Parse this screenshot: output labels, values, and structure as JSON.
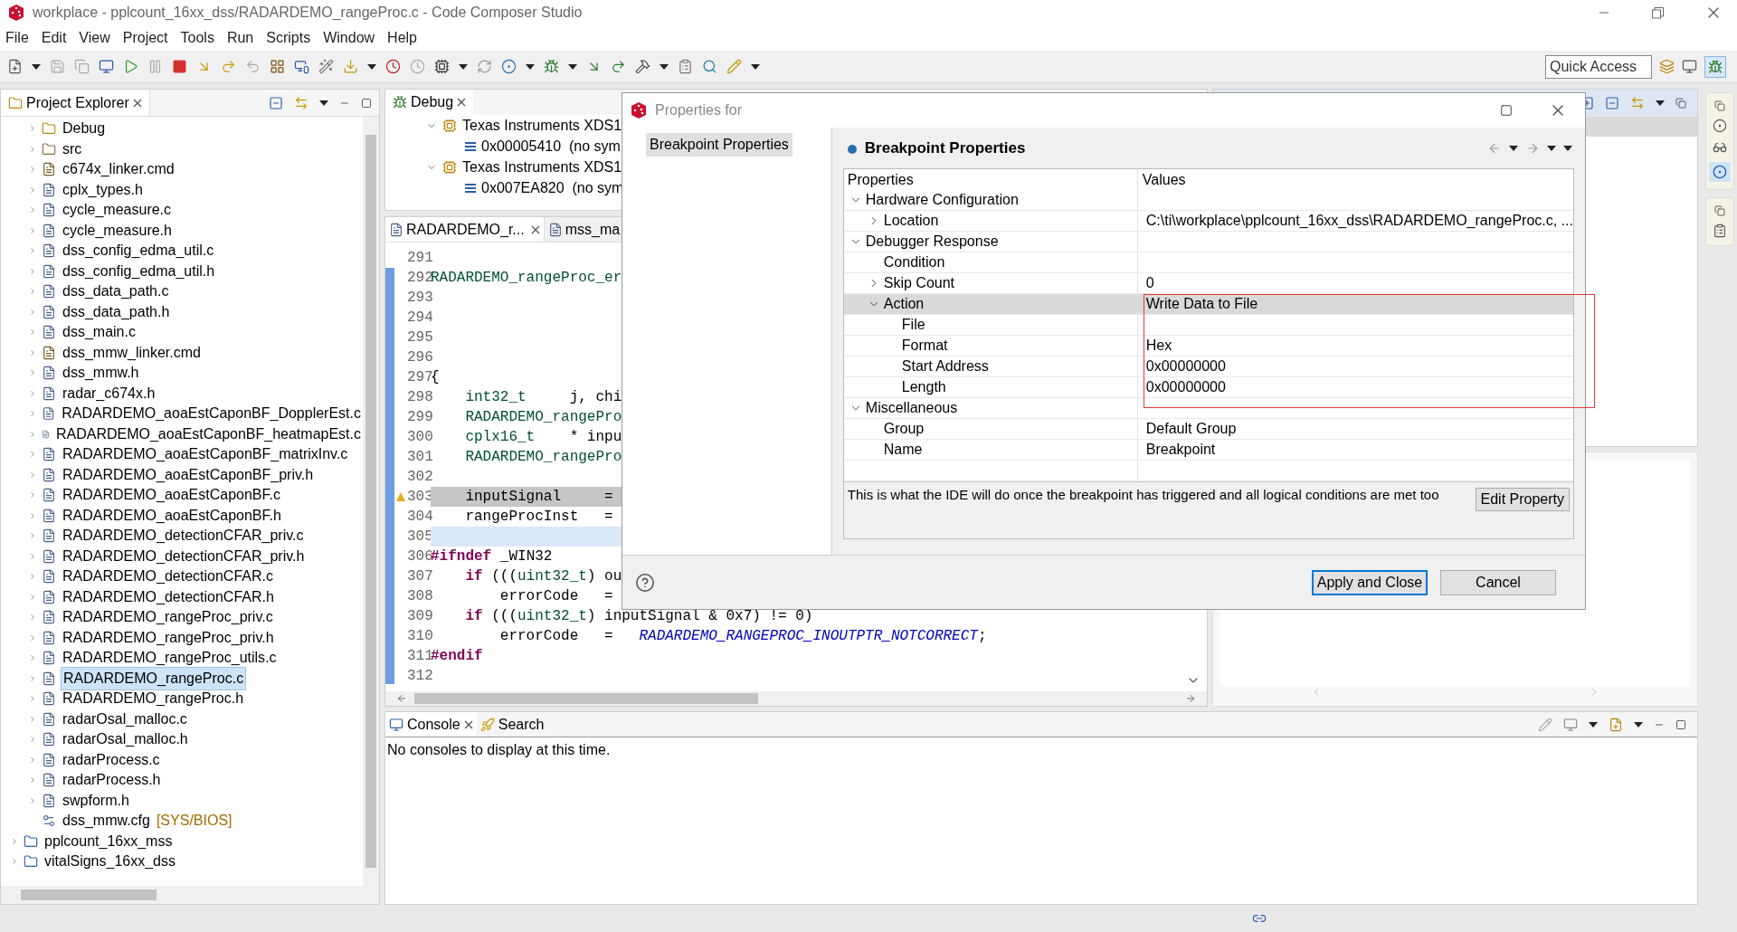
{
  "window": {
    "title": "workplace - pplcount_16xx_dss/RADARDEMO_rangeProc.c - Code Composer Studio"
  },
  "menu": [
    "File",
    "Edit",
    "View",
    "Project",
    "Tools",
    "Run",
    "Scripts",
    "Window",
    "Help"
  ],
  "quick_access": {
    "placeholder": "Quick Access"
  },
  "project_explorer": {
    "title": "Project Explorer",
    "items": [
      {
        "label": "Debug",
        "kind": "folder",
        "expandable": true,
        "selected": false
      },
      {
        "label": "src",
        "kind": "source-folder",
        "expandable": true,
        "selected": false
      },
      {
        "label": "c674x_linker.cmd",
        "kind": "cmd",
        "expandable": true,
        "selected": false
      },
      {
        "label": "cplx_types.h",
        "kind": "file",
        "expandable": true,
        "selected": false
      },
      {
        "label": "cycle_measure.c",
        "kind": "file",
        "expandable": true,
        "selected": false
      },
      {
        "label": "cycle_measure.h",
        "kind": "file",
        "expandable": true,
        "selected": false
      },
      {
        "label": "dss_config_edma_util.c",
        "kind": "file",
        "expandable": true,
        "selected": false
      },
      {
        "label": "dss_config_edma_util.h",
        "kind": "file",
        "expandable": true,
        "selected": false
      },
      {
        "label": "dss_data_path.c",
        "kind": "file",
        "expandable": true,
        "selected": false
      },
      {
        "label": "dss_data_path.h",
        "kind": "file",
        "expandable": true,
        "selected": false
      },
      {
        "label": "dss_main.c",
        "kind": "file",
        "expandable": true,
        "selected": false
      },
      {
        "label": "dss_mmw_linker.cmd",
        "kind": "cmd",
        "expandable": true,
        "selected": false
      },
      {
        "label": "dss_mmw.h",
        "kind": "file",
        "expandable": true,
        "selected": false
      },
      {
        "label": "radar_c674x.h",
        "kind": "file",
        "expandable": true,
        "selected": false
      },
      {
        "label": "RADARDEMO_aoaEstCaponBF_DopplerEst.c",
        "kind": "file",
        "expandable": true,
        "selected": false
      },
      {
        "label": "RADARDEMO_aoaEstCaponBF_heatmapEst.c",
        "kind": "file",
        "expandable": true,
        "selected": false
      },
      {
        "label": "RADARDEMO_aoaEstCaponBF_matrixInv.c",
        "kind": "file",
        "expandable": true,
        "selected": false
      },
      {
        "label": "RADARDEMO_aoaEstCaponBF_priv.h",
        "kind": "file",
        "expandable": true,
        "selected": false
      },
      {
        "label": "RADARDEMO_aoaEstCaponBF.c",
        "kind": "file",
        "expandable": true,
        "selected": false
      },
      {
        "label": "RADARDEMO_aoaEstCaponBF.h",
        "kind": "file",
        "expandable": true,
        "selected": false
      },
      {
        "label": "RADARDEMO_detectionCFAR_priv.c",
        "kind": "file",
        "expandable": true,
        "selected": false
      },
      {
        "label": "RADARDEMO_detectionCFAR_priv.h",
        "kind": "file",
        "expandable": true,
        "selected": false
      },
      {
        "label": "RADARDEMO_detectionCFAR.c",
        "kind": "file",
        "expandable": true,
        "selected": false
      },
      {
        "label": "RADARDEMO_detectionCFAR.h",
        "kind": "file",
        "expandable": true,
        "selected": false
      },
      {
        "label": "RADARDEMO_rangeProc_priv.c",
        "kind": "file",
        "expandable": true,
        "selected": false
      },
      {
        "label": "RADARDEMO_rangeProc_priv.h",
        "kind": "file",
        "expandable": true,
        "selected": false
      },
      {
        "label": "RADARDEMO_rangeProc_utils.c",
        "kind": "file",
        "expandable": true,
        "selected": false
      },
      {
        "label": "RADARDEMO_rangeProc.c",
        "kind": "file",
        "expandable": true,
        "selected": true
      },
      {
        "label": "RADARDEMO_rangeProc.h",
        "kind": "file",
        "expandable": true,
        "selected": false
      },
      {
        "label": "radarOsal_malloc.c",
        "kind": "file",
        "expandable": true,
        "selected": false
      },
      {
        "label": "radarOsal_malloc.h",
        "kind": "file",
        "expandable": true,
        "selected": false
      },
      {
        "label": "radarProcess.c",
        "kind": "file",
        "expandable": true,
        "selected": false
      },
      {
        "label": "radarProcess.h",
        "kind": "file",
        "expandable": true,
        "selected": false
      },
      {
        "label": "swpform.h",
        "kind": "file",
        "expandable": true,
        "selected": false
      },
      {
        "label": "dss_mmw.cfg",
        "kind": "config",
        "expandable": false,
        "selected": false,
        "decoration": "[SYS/BIOS]"
      }
    ],
    "projects": [
      {
        "label": "pplcount_16xx_mss",
        "expandable": true,
        "selected": false
      },
      {
        "label": "vitalSigns_16xx_dss",
        "expandable": true,
        "selected": false
      }
    ]
  },
  "debug": {
    "title": "Debug",
    "targets": [
      {
        "label": "Texas Instruments XDS1",
        "expanded": true,
        "frames": [
          "0x00005410  (no sym"
        ]
      },
      {
        "label": "Texas Instruments XDS1",
        "expanded": true,
        "frames": [
          "0x007EA820  (no sym"
        ]
      }
    ]
  },
  "editor": {
    "tabs": [
      {
        "label": "RADARDEMO_r...",
        "selected": true
      },
      {
        "label": "mss_ma",
        "selected": false
      }
    ],
    "lines": [
      {
        "number": "291",
        "current": false,
        "cursor": false
      },
      {
        "number": "292",
        "current": false,
        "cursor": false,
        "segments": [
          {
            "kind": "type",
            "text": "RADARDEMO_rangeProc_er"
          }
        ]
      },
      {
        "number": "293",
        "current": false,
        "cursor": false
      },
      {
        "number": "294",
        "current": false,
        "cursor": false
      },
      {
        "number": "295",
        "current": false,
        "cursor": false
      },
      {
        "number": "296",
        "current": false,
        "cursor": false
      },
      {
        "number": "297",
        "current": false,
        "cursor": false,
        "segments": [
          {
            "kind": "text",
            "text": "{"
          }
        ]
      },
      {
        "number": "298",
        "current": false,
        "cursor": false,
        "segments": [
          {
            "kind": "type",
            "text": "    int32_t"
          },
          {
            "kind": "text",
            "text": "     j, chi"
          }
        ]
      },
      {
        "number": "299",
        "current": false,
        "cursor": false,
        "segments": [
          {
            "kind": "type",
            "text": "    RADARDEMO_rangePro"
          }
        ]
      },
      {
        "number": "300",
        "current": false,
        "cursor": false,
        "segments": [
          {
            "kind": "type",
            "text": "    cplx16_t"
          },
          {
            "kind": "text",
            "text": "    * inpu"
          }
        ]
      },
      {
        "number": "301",
        "current": false,
        "cursor": false,
        "segments": [
          {
            "kind": "type",
            "text": "    RADARDEMO_rangePro"
          }
        ]
      },
      {
        "number": "302",
        "current": false,
        "cursor": false
      },
      {
        "number": "303",
        "current": true,
        "cursor": false,
        "breakpoint": true,
        "segments": [
          {
            "kind": "text",
            "text": "    inputSignal     ="
          }
        ]
      },
      {
        "number": "304",
        "current": false,
        "cursor": false,
        "segments": [
          {
            "kind": "text",
            "text": "    rangeProcInst   ="
          }
        ]
      },
      {
        "number": "305",
        "current": false,
        "cursor": true
      },
      {
        "number": "306",
        "current": false,
        "cursor": false,
        "segments": [
          {
            "kind": "keyword",
            "text": "#ifndef"
          },
          {
            "kind": "text",
            "text": " _WIN32"
          }
        ]
      },
      {
        "number": "307",
        "current": false,
        "cursor": false,
        "segments": [
          {
            "kind": "keyword",
            "text": "    if"
          },
          {
            "kind": "text",
            "text": " ((("
          },
          {
            "kind": "type",
            "text": "uint32_t"
          },
          {
            "kind": "text",
            "text": ") ou"
          }
        ]
      },
      {
        "number": "308",
        "current": false,
        "cursor": false,
        "segments": [
          {
            "kind": "text",
            "text": "        errorCode   ="
          }
        ]
      },
      {
        "number": "309",
        "current": false,
        "cursor": false,
        "segments": [
          {
            "kind": "keyword",
            "text": "    if"
          },
          {
            "kind": "text",
            "text": " ((("
          },
          {
            "kind": "type",
            "text": "uint32_t"
          },
          {
            "kind": "text",
            "text": ") inputSignal & 0x7) != 0)"
          }
        ]
      },
      {
        "number": "310",
        "current": false,
        "cursor": false,
        "segments": [
          {
            "kind": "text",
            "text": "        errorCode   =   "
          },
          {
            "kind": "macro",
            "text": "RADARDEMO_RANGEPROC_INOUTPTR_NOTCORRECT"
          },
          {
            "kind": "text",
            "text": ";"
          }
        ]
      },
      {
        "number": "311",
        "current": false,
        "cursor": false,
        "segments": [
          {
            "kind": "keyword",
            "text": "#endif"
          }
        ]
      },
      {
        "number": "312",
        "current": false,
        "cursor": false
      }
    ]
  },
  "dialog": {
    "title": "Properties for",
    "nav": [
      {
        "label": "Breakpoint Properties",
        "selected": true
      }
    ],
    "heading": "Breakpoint Properties",
    "columns": [
      "Properties",
      "Values"
    ],
    "rows": [
      {
        "label": "Hardware Configuration",
        "expanded": true,
        "selected": false,
        "children": [
          {
            "label": "Location",
            "value": "C:\\ti\\workplace\\pplcount_16xx_dss\\RADARDEMO_rangeProc.c, ...",
            "expanded": false,
            "selected": false
          }
        ]
      },
      {
        "label": "Debugger Response",
        "expanded": true,
        "selected": false,
        "children": [
          {
            "label": "Condition",
            "selected": false
          },
          {
            "label": "Skip Count",
            "value": "0",
            "expanded": false,
            "selected": false
          },
          {
            "label": "Action",
            "value": "Write Data to File",
            "expanded": true,
            "selected": true,
            "children": [
              {
                "label": "File",
                "selected": false
              },
              {
                "label": "Format",
                "value": "Hex",
                "selected": false
              },
              {
                "label": "Start Address",
                "value": "0x00000000",
                "selected": false
              },
              {
                "label": "Length",
                "value": "0x00000000",
                "selected": false
              }
            ]
          }
        ]
      },
      {
        "label": "Miscellaneous",
        "expanded": true,
        "selected": false,
        "children": [
          {
            "label": "Group",
            "value": "Default Group",
            "selected": false
          },
          {
            "label": "Name",
            "value": "Breakpoint",
            "selected": false
          }
        ]
      }
    ],
    "description": "This is what the IDE will do once the breakpoint has triggered and all logical conditions are met too",
    "edit_button": "Edit Property",
    "buttons": [
      {
        "label": "Apply and Close",
        "default": true
      },
      {
        "label": "Cancel",
        "default": false
      }
    ]
  },
  "console": {
    "tabs": [
      {
        "label": "Console",
        "selected": true
      },
      {
        "label": "Search",
        "selected": false
      }
    ],
    "message": "No consoles to display at this time."
  }
}
